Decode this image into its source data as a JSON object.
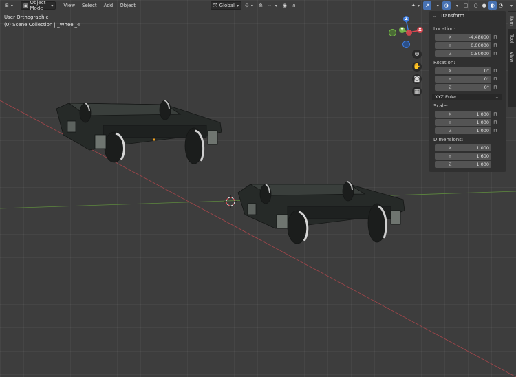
{
  "header": {
    "mode_label": "Object Mode",
    "menus": [
      "View",
      "Select",
      "Add",
      "Object"
    ],
    "transform_orientation": "Global"
  },
  "viewport": {
    "view_name": "User Orthographic",
    "collection_path": "(0) Scene Collection | _Wheel_4"
  },
  "gizmo": {
    "x": "X",
    "y": "Y",
    "z": "Z"
  },
  "sidebar_tabs": [
    "Item",
    "Tool",
    "View"
  ],
  "panel": {
    "title": "Transform",
    "location_label": "Location:",
    "location": [
      {
        "axis": "X",
        "value": "-4.48000"
      },
      {
        "axis": "Y",
        "value": "0.00000"
      },
      {
        "axis": "Z",
        "value": "0.50000"
      }
    ],
    "rotation_label": "Rotation:",
    "rotation": [
      {
        "axis": "X",
        "value": "0°"
      },
      {
        "axis": "Y",
        "value": "0°"
      },
      {
        "axis": "Z",
        "value": "0°"
      }
    ],
    "rotation_mode": "XYZ Euler",
    "scale_label": "Scale:",
    "scale": [
      {
        "axis": "X",
        "value": "1.000"
      },
      {
        "axis": "Y",
        "value": "1.000"
      },
      {
        "axis": "Z",
        "value": "1.000"
      }
    ],
    "dimensions_label": "Dimensions:",
    "dimensions": [
      {
        "axis": "X",
        "value": "1.000"
      },
      {
        "axis": "Y",
        "value": "1.600"
      },
      {
        "axis": "Z",
        "value": "1.000"
      }
    ]
  },
  "colors": {
    "viewport_bg": "#3d3d3d",
    "x_axis": "#d9464f",
    "y_axis": "#74b34a",
    "z_axis": "#3f7de0",
    "accent": "#4772b3"
  }
}
